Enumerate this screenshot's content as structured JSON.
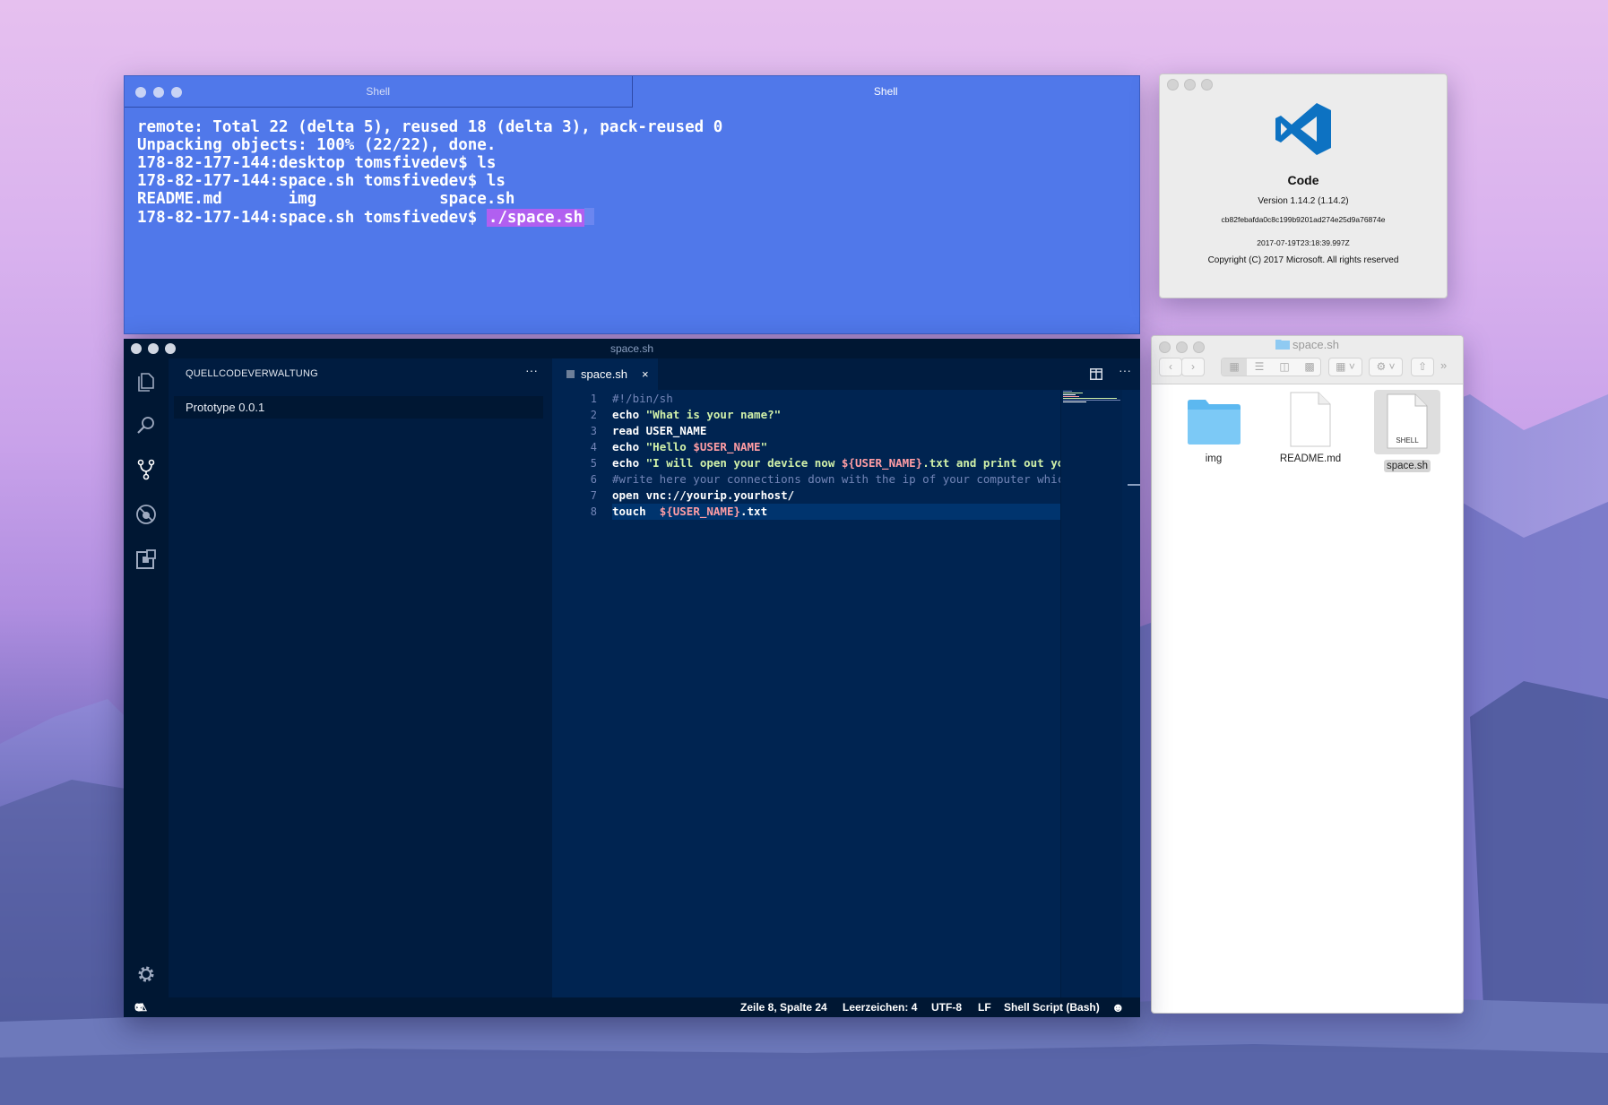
{
  "terminal": {
    "tabs": [
      {
        "label": "Shell",
        "active": false
      },
      {
        "label": "Shell",
        "active": true
      }
    ],
    "lines": [
      "remote: Total 22 (delta 5), reused 18 (delta 3), pack-reused 0",
      "Unpacking objects: 100% (22/22), done.",
      "178-82-177-144:desktop tomsfivedev$ ls",
      "178-82-177-144:space.sh tomsfivedev$ ls",
      "README.md       img             space.sh"
    ],
    "last_prompt": "178-82-177-144:space.sh tomsfivedev$ ",
    "last_command": "./space.sh",
    "colors": {
      "background": "#5078ea",
      "highlight": "#b15ff0"
    }
  },
  "about": {
    "app_name": "Code",
    "version": "Version 1.14.2 (1.14.2)",
    "commit": "cb82febafda0c8c199b9201ad274e25d9a76874e",
    "date": "2017-07-19T23:18:39.997Z",
    "copyright": "Copyright (C) 2017 Microsoft. All rights reserved",
    "logo_icon": "vscode-logo-icon",
    "logo_color": "#0d72c2"
  },
  "finder": {
    "title": "space.sh",
    "toolbar": [
      "back",
      "forward",
      "icon-view",
      "list-view",
      "column-view",
      "cover-flow",
      "arrange",
      "action",
      "share",
      "more"
    ],
    "items": [
      {
        "name": "img",
        "kind": "folder",
        "selected": false
      },
      {
        "name": "README.md",
        "kind": "document",
        "selected": false
      },
      {
        "name": "space.sh",
        "kind": "shell",
        "badge": "SHELL",
        "selected": true
      }
    ]
  },
  "vscode": {
    "window_title": "space.sh",
    "activity": [
      "explorer-icon",
      "search-icon",
      "source-control-icon",
      "debug-icon",
      "extensions-icon"
    ],
    "sidebar": {
      "title": "QUELLCODEVERWALTUNG",
      "more": "···",
      "items": [
        {
          "label": "Prototype 0.0.1"
        }
      ]
    },
    "tab": {
      "name": "space.sh",
      "close": "×"
    },
    "line_numbers": [
      "1",
      "2",
      "3",
      "4",
      "5",
      "6",
      "7",
      "8"
    ],
    "code": [
      {
        "t": "cmt",
        "s": "#!/bin/sh"
      },
      [
        {
          "t": "kw",
          "s": "echo "
        },
        {
          "t": "str",
          "s": "\"What is your name?\""
        }
      ],
      [
        {
          "t": "kw",
          "s": "read USER_NAME"
        }
      ],
      [
        {
          "t": "kw",
          "s": "echo "
        },
        {
          "t": "str",
          "s": "\"Hello "
        },
        {
          "t": "var",
          "s": "$USER_NAME"
        },
        {
          "t": "str",
          "s": "\""
        }
      ],
      [
        {
          "t": "kw",
          "s": "echo "
        },
        {
          "t": "str",
          "s": "\"I will open your device now "
        },
        {
          "t": "var",
          "s": "${USER_NAME}"
        },
        {
          "t": "str",
          "s": ".txt and print out your"
        }
      ],
      {
        "t": "cmt",
        "s": "#write here your connections down with the ip of your computer which c"
      },
      [
        {
          "t": "kw",
          "s": "open vnc://yourip.yourhost/"
        }
      ],
      [
        {
          "t": "kw",
          "s": "touch  "
        },
        {
          "t": "var",
          "s": "${USER_NAME}"
        },
        {
          "t": "kw",
          "s": ".txt"
        }
      ]
    ],
    "current_line": 8,
    "status": {
      "errors": "0",
      "warnings": "0",
      "position": "Zeile 8, Spalte 24",
      "indent": "Leerzeichen: 4",
      "encoding": "UTF-8",
      "eol": "LF",
      "language": "Shell Script (Bash)",
      "feedback_icon": "smiley-icon"
    },
    "colors": {
      "editor": "#002451",
      "sidebar": "#001c40",
      "activity": "#001733"
    }
  }
}
